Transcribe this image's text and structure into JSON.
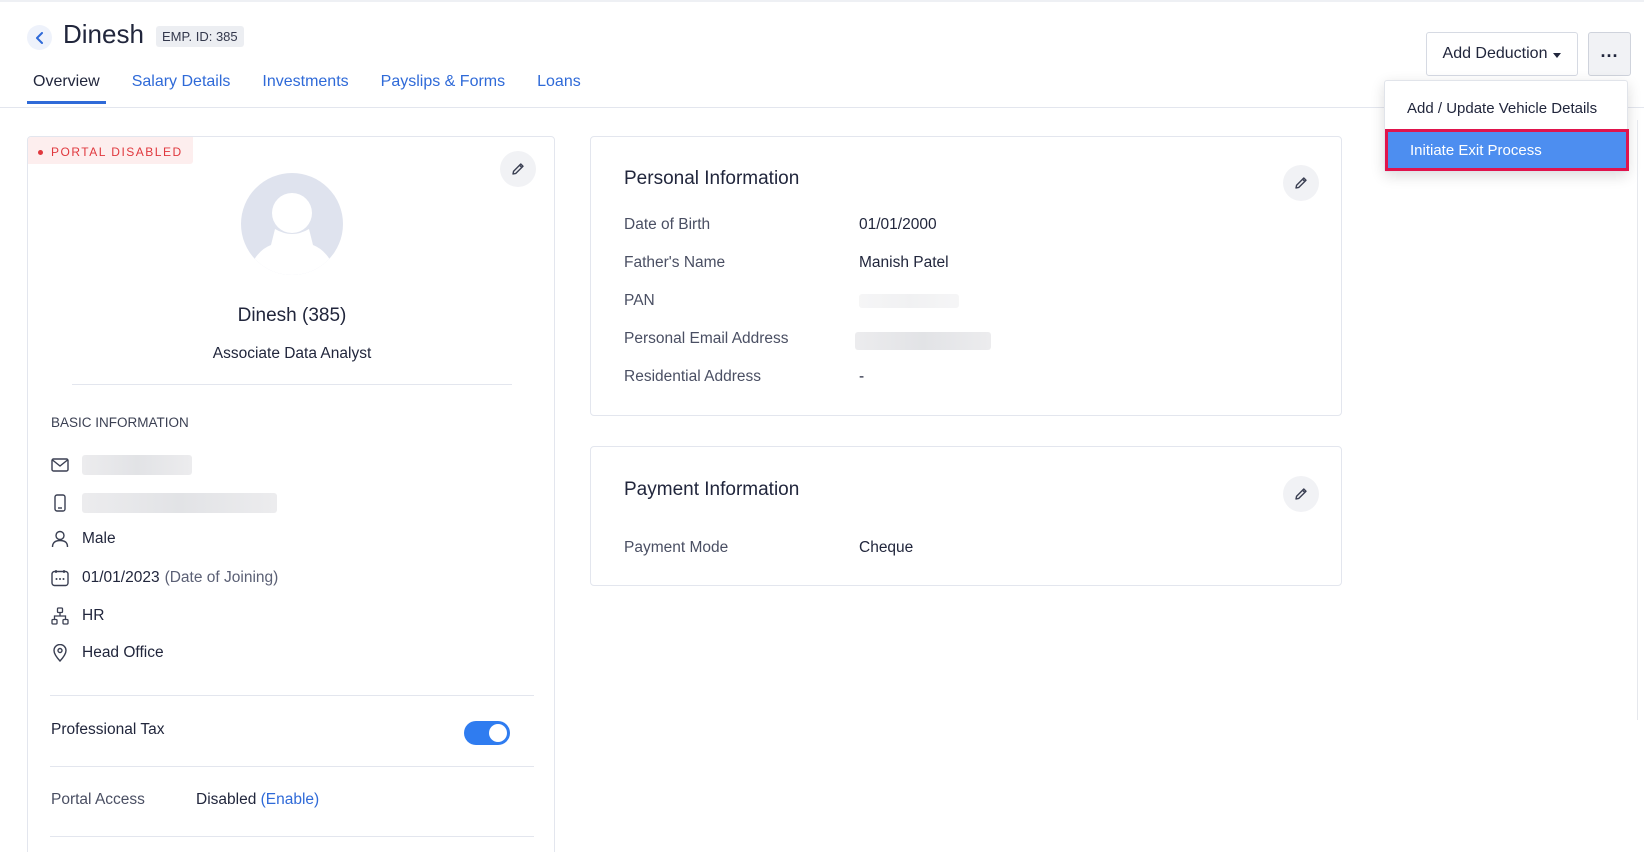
{
  "header": {
    "employee_name": "Dinesh",
    "emp_id_badge": "EMP. ID: 385",
    "tabs": [
      {
        "label": "Overview",
        "active": true
      },
      {
        "label": "Salary Details",
        "active": false
      },
      {
        "label": "Investments",
        "active": false
      },
      {
        "label": "Payslips & Forms",
        "active": false
      },
      {
        "label": "Loans",
        "active": false
      }
    ],
    "add_deduction_label": "Add Deduction",
    "more_label": "..."
  },
  "dropdown": {
    "items": [
      {
        "label": "Add / Update Vehicle Details",
        "highlighted": false
      },
      {
        "label": "Initiate Exit Process",
        "highlighted": true
      }
    ]
  },
  "profile": {
    "portal_badge": "PORTAL DISABLED",
    "name": "Dinesh (385)",
    "role": "Associate Data Analyst",
    "basic_info_label": "BASIC INFORMATION",
    "gender": "Male",
    "joining_date": "01/01/2023",
    "joining_suffix": "(Date of Joining)",
    "department": "HR",
    "location": "Head Office",
    "professional_tax_label": "Professional Tax",
    "professional_tax_enabled": true,
    "portal_access_label": "Portal Access",
    "portal_access_value": "Disabled",
    "portal_access_link": "(Enable)"
  },
  "personal_info": {
    "title": "Personal Information",
    "fields": [
      {
        "label": "Date of Birth",
        "value": "01/01/2000"
      },
      {
        "label": "Father's Name",
        "value": "Manish Patel"
      },
      {
        "label": "PAN",
        "value": ""
      },
      {
        "label": "Personal Email Address",
        "value": ""
      },
      {
        "label": "Residential Address",
        "value": "-"
      }
    ]
  },
  "payment_info": {
    "title": "Payment Information",
    "fields": [
      {
        "label": "Payment Mode",
        "value": "Cheque"
      }
    ]
  },
  "colors": {
    "accent": "#2f6ad8",
    "danger": "#e0383e",
    "highlight": "#4d8ef0",
    "highlight_border": "#e0144c"
  }
}
